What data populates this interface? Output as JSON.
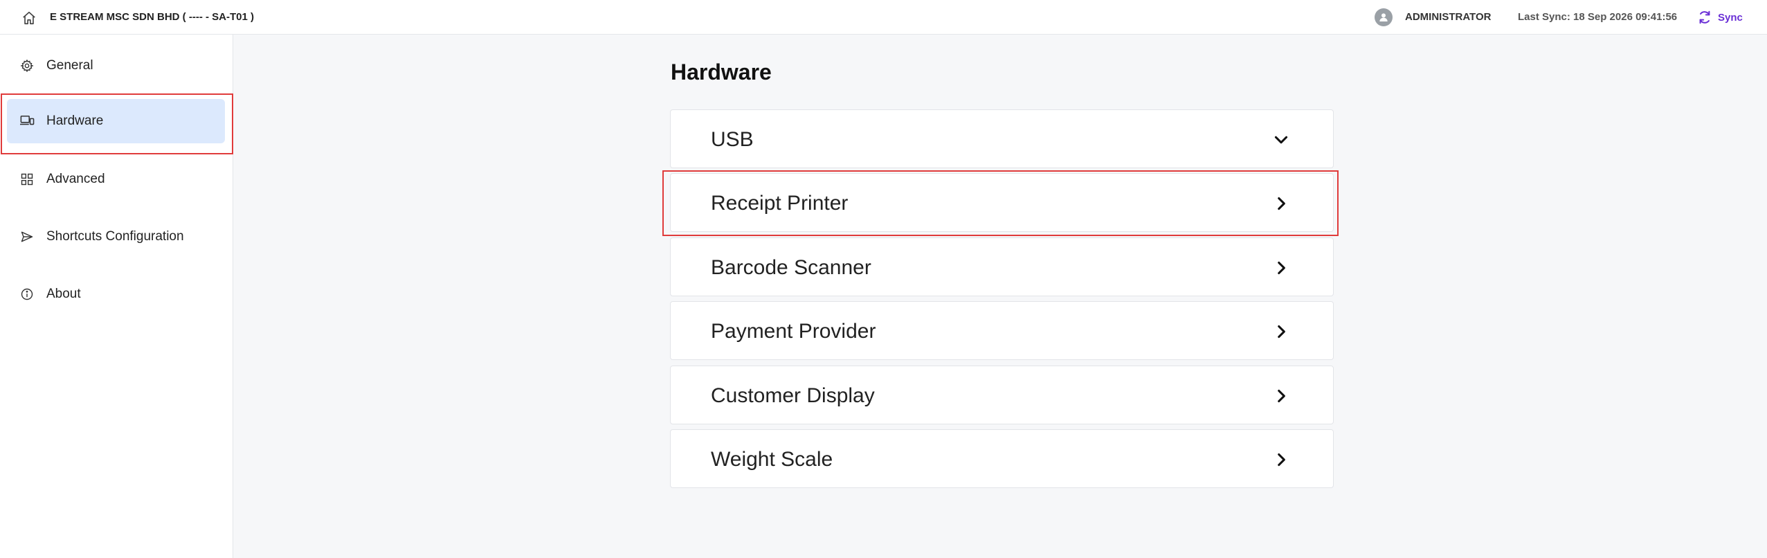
{
  "header": {
    "company": "E STREAM MSC SDN BHD ( ---- - SA-T01 )",
    "user": "ADMINISTRATOR",
    "last_sync": "Last Sync: 18 Sep 2026 09:41:56",
    "sync_label": "Sync",
    "accent_color": "#6a2fd6"
  },
  "sidebar": {
    "items": [
      {
        "label": "General",
        "icon": "gear-icon"
      },
      {
        "label": "Hardware",
        "icon": "devices-icon",
        "active": true
      },
      {
        "label": "Advanced",
        "icon": "dashboard-icon"
      },
      {
        "label": "Shortcuts Configuration",
        "icon": "send-icon"
      },
      {
        "label": "About",
        "icon": "info-icon"
      }
    ],
    "active_color": "#dce9fd"
  },
  "main": {
    "title": "Hardware",
    "sections": [
      {
        "label": "USB",
        "icon": "chevron-down-icon"
      },
      {
        "label": "Receipt Printer",
        "icon": "chevron-right-icon"
      },
      {
        "label": "Barcode Scanner",
        "icon": "chevron-right-icon"
      },
      {
        "label": "Payment Provider",
        "icon": "chevron-right-icon"
      },
      {
        "label": "Customer Display",
        "icon": "chevron-right-icon"
      },
      {
        "label": "Weight Scale",
        "icon": "chevron-right-icon"
      }
    ]
  },
  "highlight_color": "#e03b3b"
}
